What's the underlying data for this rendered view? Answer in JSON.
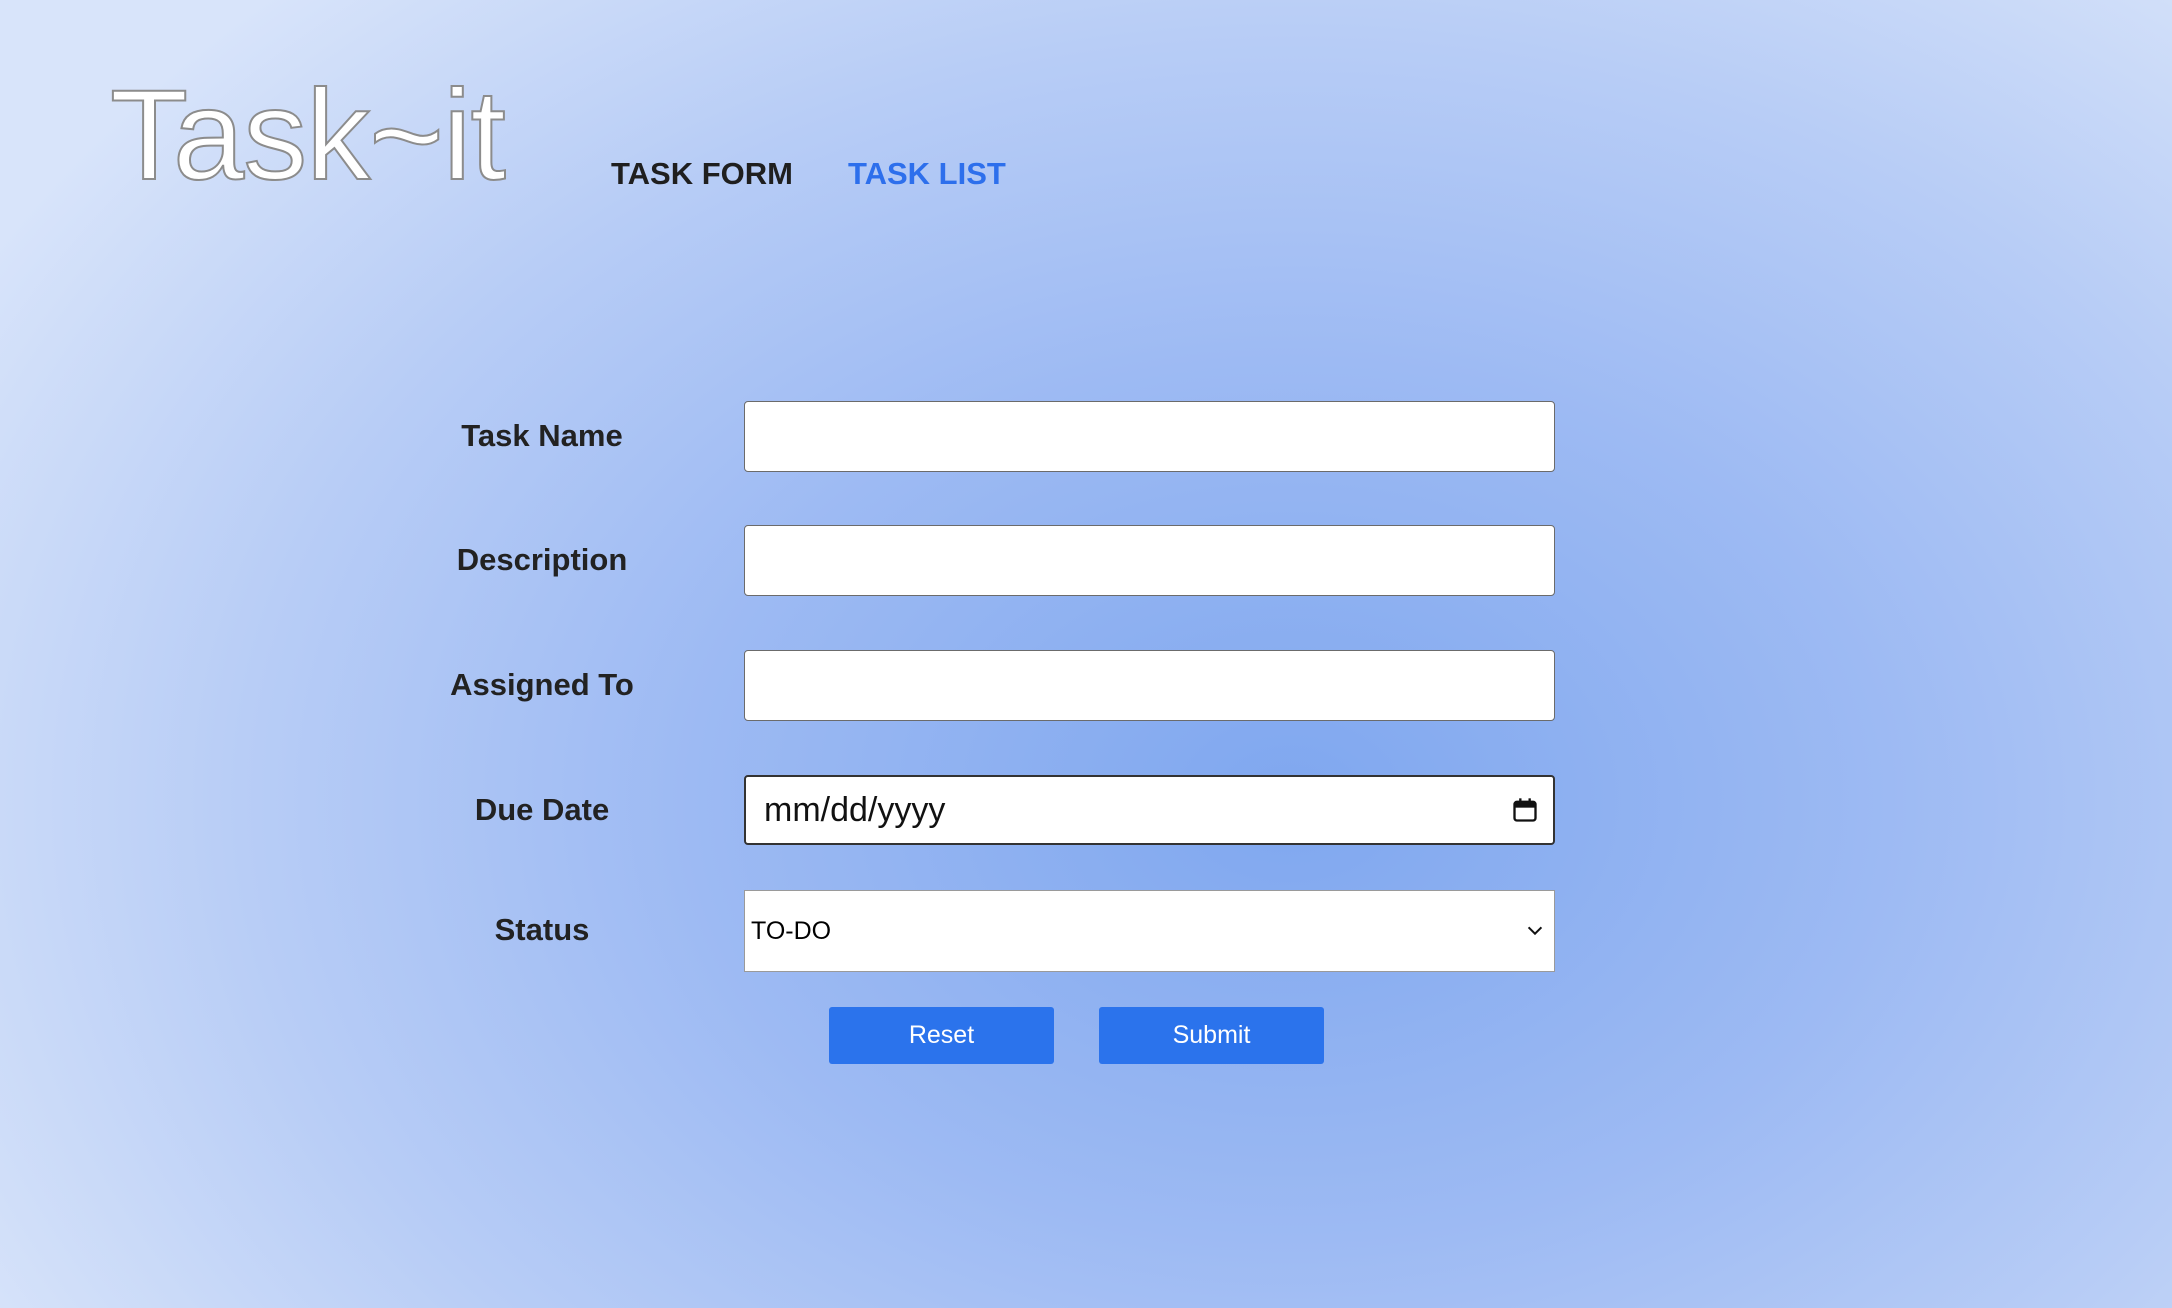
{
  "app": {
    "logo_text": "Task~it"
  },
  "nav": {
    "items": [
      {
        "label": "TASK FORM",
        "active": true
      },
      {
        "label": "TASK LIST",
        "active": false
      }
    ]
  },
  "form": {
    "task_name_label": "Task Name",
    "task_name_value": "",
    "description_label": "Description",
    "description_value": "",
    "assigned_to_label": "Assigned To",
    "assigned_to_value": "",
    "due_date_label": "Due Date",
    "due_date_placeholder": "mm/dd/yyyy",
    "status_label": "Status",
    "status_value": "TO-DO",
    "reset_label": "Reset",
    "submit_label": "Submit"
  },
  "icons": {
    "calendar": "calendar-icon",
    "dropdown": "chevron-down-icon"
  },
  "colors": {
    "accent": "#2b73ec",
    "nav_active": "#1f1f1f",
    "nav_link": "#2d6fec"
  }
}
